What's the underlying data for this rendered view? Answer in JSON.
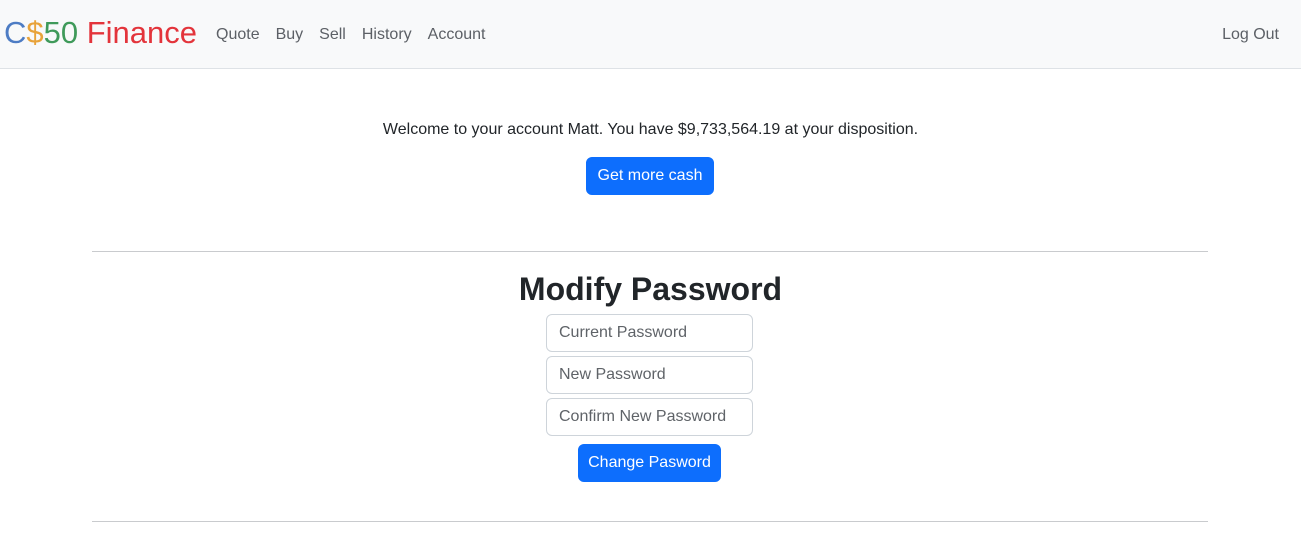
{
  "navbar": {
    "brand": {
      "c": "C",
      "dollar": "$",
      "fifty": "50",
      "finance": " Finance"
    },
    "links": [
      "Quote",
      "Buy",
      "Sell",
      "History",
      "Account"
    ],
    "logout": "Log Out"
  },
  "account": {
    "welcome": "Welcome to your account Matt. You have $9,733,564.19 at your disposition.",
    "cash_button": "Get more cash"
  },
  "password_form": {
    "title": "Modify Password",
    "current_placeholder": "Current Password",
    "new_placeholder": "New Password",
    "confirm_placeholder": "Confirm New Password",
    "submit": "Change Pasword"
  },
  "colors": {
    "primary": "#0d6efd",
    "navbar_bg": "#f8f9fa",
    "brand_c": "#4d7cc4",
    "brand_dollar": "#e8a33a",
    "brand_50": "#3f9a5a",
    "brand_finance": "#e3343b"
  }
}
